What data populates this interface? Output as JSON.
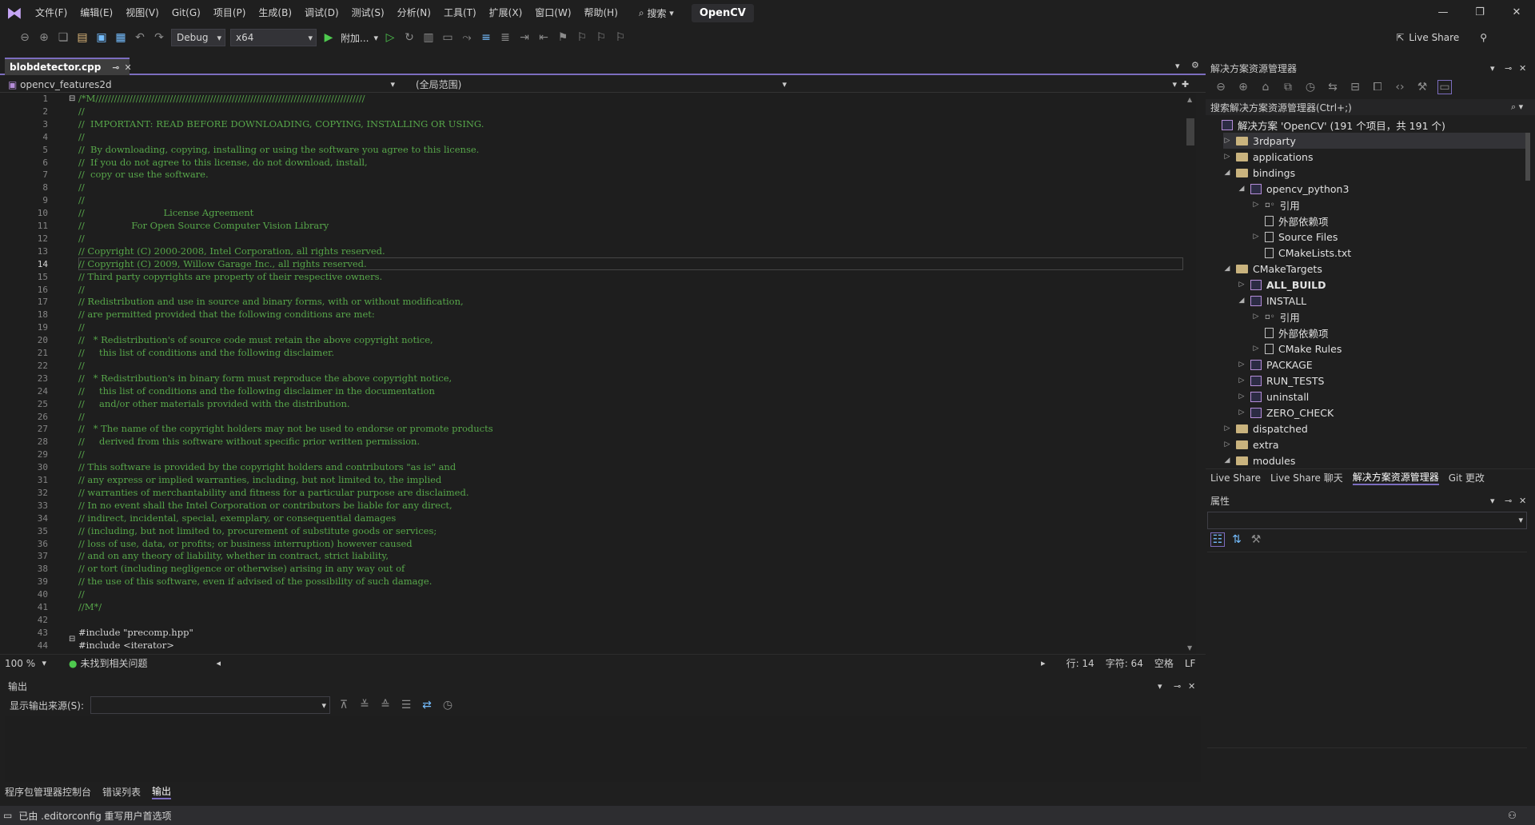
{
  "menu": [
    "文件(F)",
    "编辑(E)",
    "视图(V)",
    "Git(G)",
    "项目(P)",
    "生成(B)",
    "调试(D)",
    "测试(S)",
    "分析(N)",
    "工具(T)",
    "扩展(X)",
    "窗口(W)",
    "帮助(H)"
  ],
  "search_label": "搜索",
  "solution_name": "OpenCV",
  "window_controls": [
    "—",
    "❐",
    "✕"
  ],
  "toolbar": {
    "config": "Debug",
    "platform": "x64",
    "attach_label": "附加...",
    "live_share": "Live Share"
  },
  "editor": {
    "tab_name": "blobdetector.cpp",
    "project_combo": "opencv_features2d",
    "scope_combo": "(全局范围)",
    "current_line": 14,
    "lines": [
      "/*M///////////////////////////////////////////////////////////////////////////////////////",
      "//",
      "//  IMPORTANT: READ BEFORE DOWNLOADING, COPYING, INSTALLING OR USING.",
      "//",
      "//  By downloading, copying, installing or using the software you agree to this license.",
      "//  If you do not agree to this license, do not download, install,",
      "//  copy or use the software.",
      "//",
      "//",
      "//                           License Agreement",
      "//                For Open Source Computer Vision Library",
      "//",
      "// Copyright (C) 2000-2008, Intel Corporation, all rights reserved.",
      "// Copyright (C) 2009, Willow Garage Inc., all rights reserved.",
      "// Third party copyrights are property of their respective owners.",
      "//",
      "// Redistribution and use in source and binary forms, with or without modification,",
      "// are permitted provided that the following conditions are met:",
      "//",
      "//   * Redistribution's of source code must retain the above copyright notice,",
      "//     this list of conditions and the following disclaimer.",
      "//",
      "//   * Redistribution's in binary form must reproduce the above copyright notice,",
      "//     this list of conditions and the following disclaimer in the documentation",
      "//     and/or other materials provided with the distribution.",
      "//",
      "//   * The name of the copyright holders may not be used to endorse or promote products",
      "//     derived from this software without specific prior written permission.",
      "//",
      "// This software is provided by the copyright holders and contributors \"as is\" and",
      "// any express or implied warranties, including, but not limited to, the implied",
      "// warranties of merchantability and fitness for a particular purpose are disclaimed.",
      "// In no event shall the Intel Corporation or contributors be liable for any direct,",
      "// indirect, incidental, special, exemplary, or consequential damages",
      "// (including, but not limited to, procurement of substitute goods or services;",
      "// loss of use, data, or profits; or business interruption) however caused",
      "// and on any theory of liability, whether in contract, strict liability,",
      "// or tort (including negligence or otherwise) arising in any way out of",
      "// the use of this software, even if advised of the possibility of such damage.",
      "//",
      "//M*/",
      "",
      "#include \"precomp.hpp\"",
      "#include <iterator>"
    ],
    "status": {
      "zoom": "100 %",
      "issues": "未找到相关问题",
      "line": "行: 14",
      "char": "字符: 64",
      "whitespace": "空格",
      "eol": "LF"
    }
  },
  "output": {
    "title": "输出",
    "source_label": "显示输出来源(S):"
  },
  "bottom_tabs": [
    "程序包管理器控制台",
    "错误列表",
    "输出"
  ],
  "statusbar": {
    "message": "已由 .editorconfig 重写用户首选项"
  },
  "solution_explorer": {
    "title": "解决方案资源管理器",
    "search_placeholder": "搜索解决方案资源管理器(Ctrl+;)",
    "items": [
      {
        "label": "解决方案 'OpenCV' (191 个项目，共 191 个)",
        "level": 0,
        "kind": "solution",
        "toggle": ""
      },
      {
        "label": "3rdparty",
        "level": 1,
        "kind": "folder",
        "toggle": "▷",
        "selected": true
      },
      {
        "label": "applications",
        "level": 1,
        "kind": "folder",
        "toggle": "▷"
      },
      {
        "label": "bindings",
        "level": 1,
        "kind": "folder",
        "toggle": "◢"
      },
      {
        "label": "opencv_python3",
        "level": 2,
        "kind": "project",
        "toggle": "◢"
      },
      {
        "label": "引用",
        "level": 3,
        "kind": "ref",
        "toggle": "▷"
      },
      {
        "label": "外部依赖项",
        "level": 3,
        "kind": "dep",
        "toggle": ""
      },
      {
        "label": "Source Files",
        "level": 3,
        "kind": "filter",
        "toggle": "▷"
      },
      {
        "label": "CMakeLists.txt",
        "level": 3,
        "kind": "file",
        "toggle": ""
      },
      {
        "label": "CMakeTargets",
        "level": 1,
        "kind": "folder",
        "toggle": "◢"
      },
      {
        "label": "ALL_BUILD",
        "level": 2,
        "kind": "project",
        "toggle": "▷",
        "bold": true
      },
      {
        "label": "INSTALL",
        "level": 2,
        "kind": "project",
        "toggle": "◢"
      },
      {
        "label": "引用",
        "level": 3,
        "kind": "ref",
        "toggle": "▷"
      },
      {
        "label": "外部依赖项",
        "level": 3,
        "kind": "dep",
        "toggle": ""
      },
      {
        "label": "CMake Rules",
        "level": 3,
        "kind": "filter",
        "toggle": "▷"
      },
      {
        "label": "PACKAGE",
        "level": 2,
        "kind": "project",
        "toggle": "▷"
      },
      {
        "label": "RUN_TESTS",
        "level": 2,
        "kind": "project",
        "toggle": "▷"
      },
      {
        "label": "uninstall",
        "level": 2,
        "kind": "project",
        "toggle": "▷"
      },
      {
        "label": "ZERO_CHECK",
        "level": 2,
        "kind": "project",
        "toggle": "▷"
      },
      {
        "label": "dispatched",
        "level": 1,
        "kind": "folder",
        "toggle": "▷"
      },
      {
        "label": "extra",
        "level": 1,
        "kind": "folder",
        "toggle": "▷"
      },
      {
        "label": "modules",
        "level": 1,
        "kind": "folder",
        "toggle": "◢"
      }
    ],
    "tabs": [
      "Live Share",
      "Live Share 聊天",
      "解决方案资源管理器",
      "Git 更改"
    ]
  },
  "properties": {
    "title": "属性"
  },
  "colors": {
    "comment": "#57a64a",
    "accent": "#7c6dbf",
    "background": "#1e1e1e"
  }
}
